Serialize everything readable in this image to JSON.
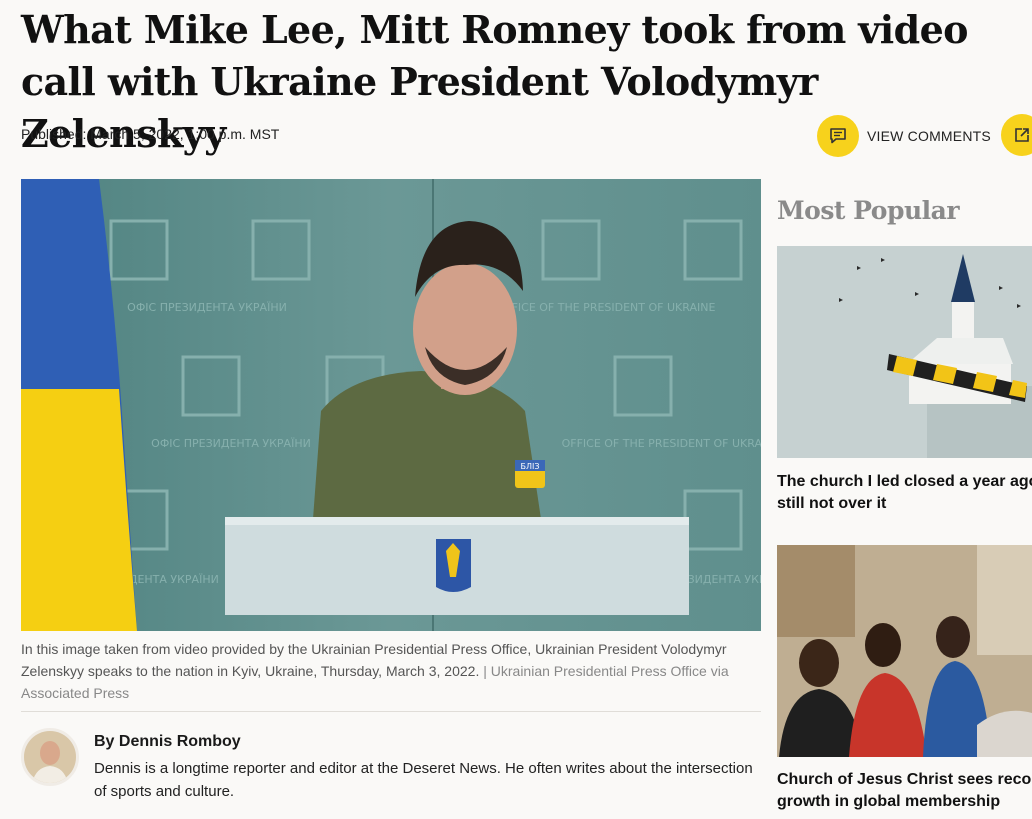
{
  "article": {
    "headline": "What Mike Lee, Mitt Romney took from video call with Ukraine President Volodymyr Zelenskyy",
    "published": "Published: March 5, 2022, 1:00 p.m. MST",
    "view_comments_label": "VIEW COMMENTS",
    "caption": "In this image taken from video provided by the Ukrainian Presidential Press Office, Ukrainian President Volodymyr Zelenskyy speaks to the nation in Kyiv, Ukraine, Thursday, March 3, 2022.",
    "caption_separator": " | ",
    "caption_credit": "Ukrainian Presidential Press Office via Associated Press",
    "backdrop_text": [
      "ОФІС ПРЕЗИДЕНТА УКРАЇНИ",
      "OFFICE OF THE PRESIDENT OF UKRAINE"
    ],
    "patch_text": "БЛІЗ"
  },
  "author": {
    "byline": "By Dennis Romboy",
    "bio": "Dennis is a longtime reporter and editor at the Deseret News. He often writes about the intersection of sports and culture."
  },
  "sidebar": {
    "title": "Most Popular",
    "items": [
      {
        "title_line1": "The church I led closed a year ago. I'm",
        "title_line2": "still not over it"
      },
      {
        "title_line1": "Church of Jesus Christ sees record",
        "title_line2": "growth in global membership"
      }
    ]
  },
  "icons": {
    "comments": "comment-icon",
    "share": "share-icon"
  },
  "colors": {
    "accent": "#f7d21c",
    "background": "#faf9f7"
  }
}
